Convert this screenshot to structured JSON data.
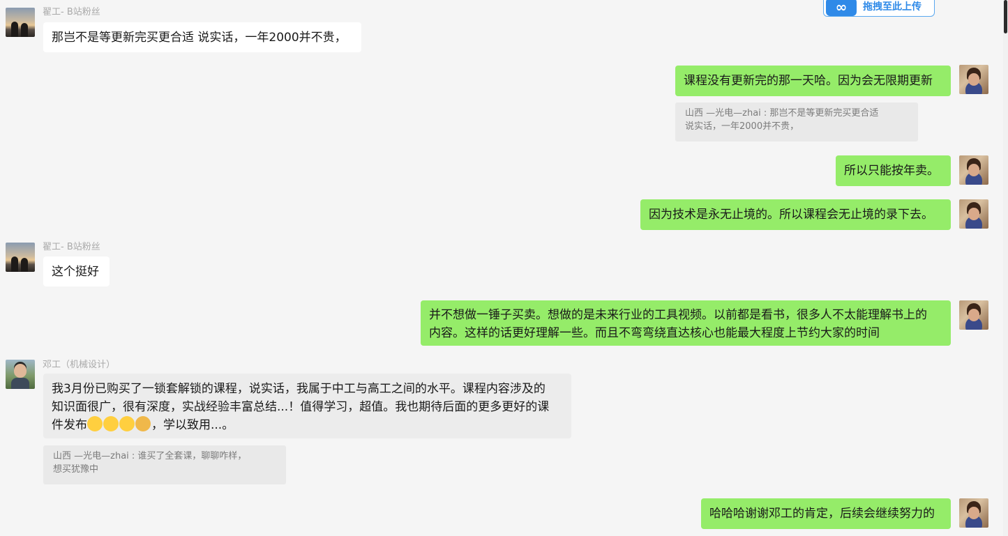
{
  "upload": {
    "icon": "∞",
    "label": "拖拽至此上传"
  },
  "messages": [
    {
      "sender": "翟工- B站粉丝",
      "text": "那岂不是等更新完买更合适 说实话，一年2000并不贵，"
    },
    {
      "text": "课程没有更新完的那一天哈。因为会无限期更新"
    },
    {
      "quote": "山西 —光电—zhai : 那岂不是等更新完买更合适 说实话，一年2000并不贵，",
      "quote_line1": "山西 —光电—zhai : 那岂不是等更新完买更合适",
      "quote_line2": "说实话，一年2000并不贵，"
    },
    {
      "text": "所以只能按年卖。"
    },
    {
      "text": "因为技术是永无止境的。所以课程会无止境的录下去。"
    },
    {
      "sender": "翟工- B站粉丝",
      "text": "这个挺好"
    },
    {
      "line1": "并不想做一锤子买卖。想做的是未来行业的工具视频。以前都是看书，很多人不太能理解书上的",
      "line2": "内容。这样的话更好理解一些。而且不弯弯绕直达核心也能最大程度上节约大家的时间"
    },
    {
      "sender": "邓工（机械设计）",
      "line1": "我3月份已购买了一锁套解锁的课程，说实话，我属于中工与高工之间的水平。课程内容涉及的",
      "line2": "知识面很广，很有深度，实战经验丰富总结...！值得学习，超值。我也期待后面的更多更好的课",
      "line3_a": "件发布",
      "line3_b": "，学以致用...。"
    },
    {
      "quote_line1": "山西 —光电—zhai : 谁买了全套课，聊聊咋样，",
      "quote_line2": "想买犹豫中"
    },
    {
      "text": "哈哈哈谢谢邓工的肯定，后续会继续努力的"
    }
  ]
}
